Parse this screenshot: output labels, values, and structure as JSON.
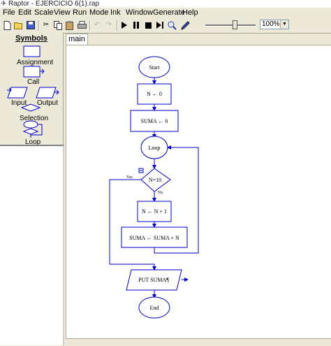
{
  "window": {
    "title": "Raptor - EJERCICIO 6(1).rap"
  },
  "menu": [
    "File",
    "Edit",
    "Scale",
    "View",
    "Run",
    "Mode",
    "Ink",
    "Window",
    "Generate",
    "Help"
  ],
  "toolbar": {
    "zoom": "100%",
    "slider_level": 0.6
  },
  "symbols": {
    "header": "Symbols",
    "assignment": "Assignment",
    "call": "Call",
    "input": "Input",
    "output": "Output",
    "selection": "Selection",
    "loop": "Loop"
  },
  "tabs": [
    "main"
  ],
  "flowchart": {
    "start": "Start",
    "assign_n0": "N ← 0",
    "assign_suma0": "SUMA ← 0",
    "loop": "Loop",
    "condition": "N=10",
    "yes": "Yes",
    "no": "No",
    "assign_inc": "N ← N + 1",
    "assign_sum": "SUMA ← SUMA + N",
    "output": "PUT SUMA¶",
    "end": "End"
  },
  "colors": {
    "flow_stroke": "#0000cd",
    "canvas": "#ffffff",
    "chrome": "#ece9d8"
  }
}
